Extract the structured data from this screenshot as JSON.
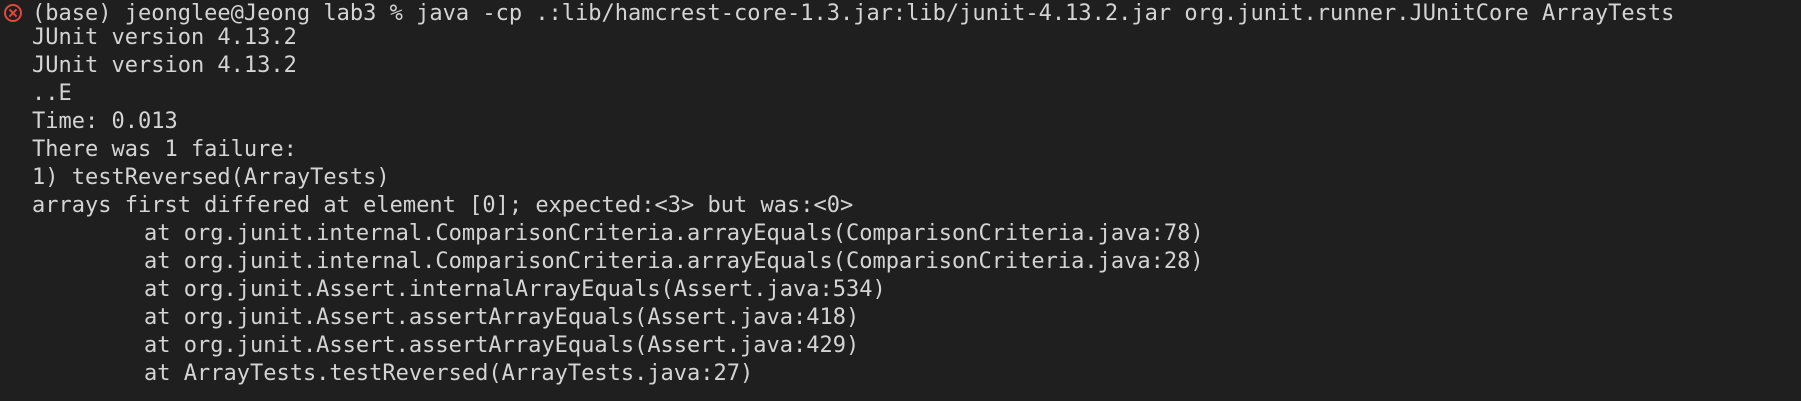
{
  "terminal": {
    "status_icon": "error-circle-icon",
    "status_color": "#e4473b",
    "command_line": "(base) jeonglee@Jeong lab3 % java -cp .:lib/hamcrest-core-1.3.jar:lib/junit-4.13.2.jar org.junit.runner.JUnitCore ArrayTests",
    "output": [
      "JUnit version 4.13.2",
      "JUnit version 4.13.2",
      "..E",
      "Time: 0.013",
      "There was 1 failure:",
      "1) testReversed(ArrayTests)",
      "arrays first differed at element [0]; expected:<3> but was:<0>"
    ],
    "stack_trace": [
      "at org.junit.internal.ComparisonCriteria.arrayEquals(ComparisonCriteria.java:78)",
      "at org.junit.internal.ComparisonCriteria.arrayEquals(ComparisonCriteria.java:28)",
      "at org.junit.Assert.internalArrayEquals(Assert.java:534)",
      "at org.junit.Assert.assertArrayEquals(Assert.java:418)",
      "at org.junit.Assert.assertArrayEquals(Assert.java:429)",
      "at ArrayTests.testReversed(ArrayTests.java:27)"
    ]
  }
}
